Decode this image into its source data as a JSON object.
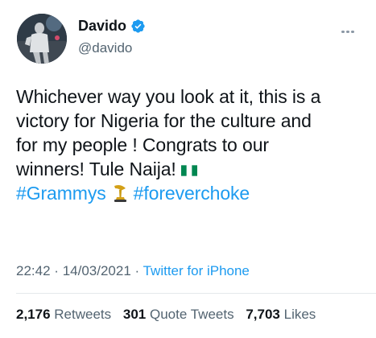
{
  "user": {
    "display_name": "Davido",
    "handle": "@davido"
  },
  "tweet": {
    "lines": [
      "Whichever way you look at it, this is a",
      "victory for Nigeria for the culture and",
      "for my people !  Congrats to our",
      "winners! Tule Naija!"
    ],
    "hashtags": [
      "#Grammys",
      "#foreverchoke"
    ],
    "emojis": [
      "nigeria-flag-icon",
      "grammy-trophy-icon"
    ]
  },
  "meta": {
    "time": "22:42",
    "date": "14/03/2021",
    "separator": "·",
    "source": "Twitter for iPhone"
  },
  "stats": {
    "retweets_count": "2,176",
    "retweets_label": "Retweets",
    "quotes_count": "301",
    "quotes_label": "Quote Tweets",
    "likes_count": "7,703",
    "likes_label": "Likes"
  },
  "colors": {
    "link": "#1d9bf0",
    "secondary_text": "#536471",
    "primary_text": "#0f1419",
    "verified": "#1d9bf0",
    "nigeria_green": "#008751"
  }
}
